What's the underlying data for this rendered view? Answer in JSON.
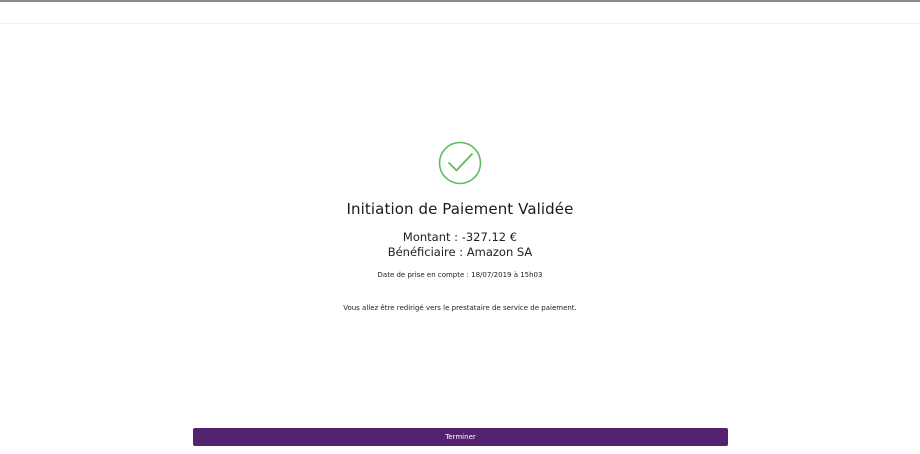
{
  "confirmation": {
    "title": "Initiation de Paiement Validée",
    "amount_label": "Montant :",
    "amount_value": "-327.12 €",
    "beneficiary_label": "Bénéficiaire :",
    "beneficiary_value": "Amazon SA",
    "date_label": "Date de prise en compte :",
    "date_value": "18/07/2019 à 15h03",
    "redirect_message": "Vous allez être redirigé vers le prestataire de service de paiement."
  },
  "actions": {
    "finish_label": "Terminer"
  },
  "colors": {
    "success_green": "#5cbf5c",
    "primary_purple": "#55226f"
  },
  "icons": {
    "status": "check-circle-icon"
  }
}
